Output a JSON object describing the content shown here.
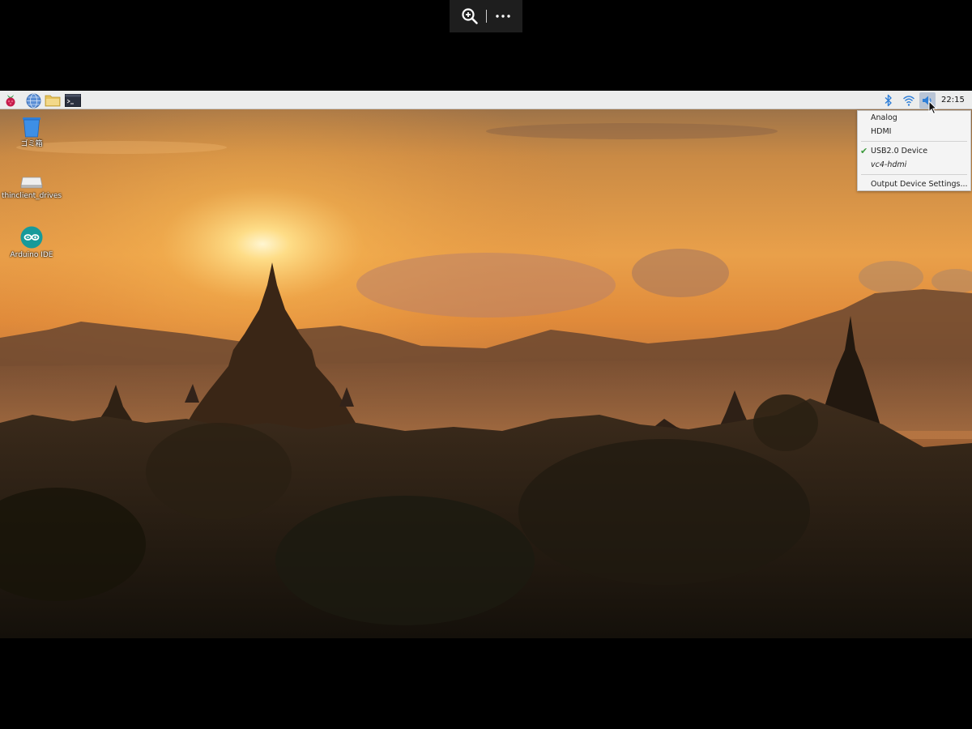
{
  "viewer_toolbar": {
    "zoom_icon": "zoom-in-icon",
    "more_icon": "more-options-icon"
  },
  "taskbar": {
    "launchers": [
      {
        "name": "raspberry-menu",
        "icon": "raspberry-pi-icon"
      },
      {
        "name": "web-browser",
        "icon": "globe-icon"
      },
      {
        "name": "file-manager",
        "icon": "folder-icon"
      },
      {
        "name": "terminal",
        "icon": "terminal-icon"
      }
    ],
    "tray": [
      {
        "name": "bluetooth",
        "icon": "bluetooth-icon"
      },
      {
        "name": "wifi",
        "icon": "wifi-icon"
      },
      {
        "name": "volume",
        "icon": "speaker-icon"
      }
    ],
    "clock": "22:15"
  },
  "desktop_icons": [
    {
      "label": "ゴミ箱",
      "icon": "trash-icon"
    },
    {
      "label": "thinclient_drives",
      "icon": "drive-icon"
    },
    {
      "label": "Arduino IDE",
      "icon": "arduino-icon"
    }
  ],
  "audio_menu": {
    "items": [
      {
        "label": "Analog"
      },
      {
        "label": "HDMI"
      },
      {
        "label": "USB2.0 Device",
        "checked": true
      },
      {
        "label": "vc4-hdmi",
        "italic": true
      },
      {
        "label": "Output Device Settings..."
      }
    ]
  },
  "colors": {
    "taskbar_bg": "#eceded",
    "menu_bg": "#f4f4f4",
    "check": "#3c9a3c",
    "sky_top": "#e89a3c",
    "sun": "#fff4c8"
  }
}
